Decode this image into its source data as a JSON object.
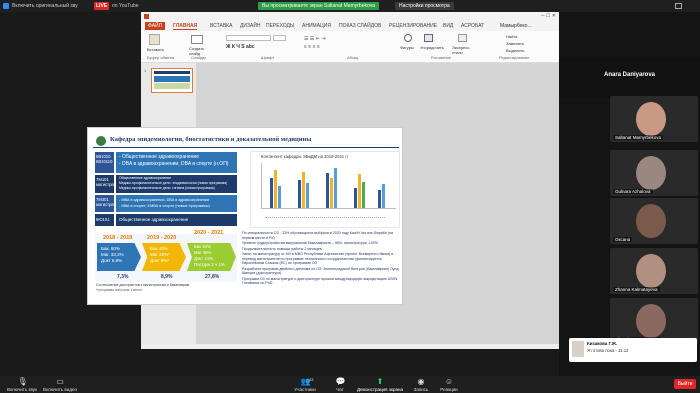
{
  "zoom": {
    "mic_label": "Включить оригинальный зву",
    "live_badge": "LIVE",
    "youtube_label": "on YouTube",
    "share_notice": "Вы просматриваете экран Saltanat Mamyrbekova",
    "view_options": "Настройки просмотра",
    "participants_count": "43",
    "toolbar": {
      "unmute": "Включить звук",
      "video": "Включить видео",
      "participants": "Участники",
      "chat": "Чат",
      "share": "Демонстрация экрана",
      "record": "Запись",
      "reactions": "Реакции",
      "leave": "Выйти"
    }
  },
  "ppt": {
    "tabs": [
      "ФАЙЛ",
      "ГЛАВНАЯ",
      "ВСТАВКА",
      "ДИЗАЙН",
      "ПЕРЕХОДЫ",
      "АНИМАЦИЯ",
      "ПОКАЗ СЛАЙДОВ",
      "РЕЦЕНЗИРОВАНИЕ",
      "ВИД",
      "АСРОБАТ"
    ],
    "user": "Мамырбеко...",
    "ribbon": {
      "paste": "Вставить",
      "create_slide": "Создать слайд",
      "clipboard": "Буфер обмена",
      "slides": "Слайды",
      "font": "Шрифт",
      "paragraph": "Абзац",
      "shapes": "Фигуры",
      "arrange": "Упорядочить",
      "quick_styles": "Экспресс-стили",
      "drawing": "Рисование",
      "find": "Найти",
      "replace": "Заменить",
      "select": "Выделить",
      "editing": "Редактирование"
    },
    "slide_number": "1"
  },
  "slide": {
    "title": "Кафедра эпидемиологии, биостатистики и доказательной медицины",
    "rows": [
      {
        "tag": "6В1010 6В10110",
        "text1": "- Общественное здравоохранение",
        "text2": "- DBA в здравоохранении, DBA в спорте (н.ОП)"
      },
      {
        "tag": "7М101 магистратура",
        "text1": "Общественное здравоохранение",
        "text2": "Медико-профилактическое дело: эпидемиология (новая программа)",
        "text3": "Медико-профилактическое дело: гигиена (новая программа)"
      },
      {
        "tag": "7М401 магистратура",
        "text1": "- МВА в здравоохранении, DBA в здравоохранении",
        "text2": "- МВА в спорте, ЕМВА в спорте (новые программы)"
      },
      {
        "tag": "8Ю101",
        "text1": "Общественное здравоохранение"
      }
    ],
    "chart_title": "Контингент кафедры ЭБиДМ на 2018-2021 гг",
    "years": [
      {
        "label": "2018 - 2019",
        "bak": "Бак.    60%",
        "mag": "Маг.    33,2%",
        "dokt": "Докт   6,8%",
        "pct": "7,3%"
      },
      {
        "label": "2019 - 2020",
        "bak": "Бак    48%",
        "mag": "Маг   45%*",
        "dokt": "Докт   9%*",
        "pct": "8,9%"
      },
      {
        "label": "2020 - 2021",
        "bak": "Бак     33%",
        "mag": "Маг    45%",
        "dokt": "Докт    21%",
        "post": "Постдок 2 ч 1%",
        "pct": "27,8%"
      }
    ],
    "footnote": "Соотношение докторантов к магистрантам и бакалаврам",
    "footnote2": "*программа получила 1 место",
    "bullets": [
      "По специальности ОЗ - 33% обучающиеся выбрали в 2020 году КазНУ им.аль-Фараби (на первом месте в РК)",
      "Уровень трудоустройства выпускников бакалавриата – 98%, магистратура -100%",
      "Продолжительность помощи работы 2 месяцев.",
      "Занят на магистратуру от МЗ в МВО Республики Афганистан (проект Всемирного банка) и перевод магистрантов по программе технического сотрудничества (финансируется Европейским Союзом (ЕС) по программе ОЗ",
      "Разработка программ двойного диплома по ОЗ: Зеленоградской Венгрия (бакалавриат) Лунд Швеция (докторантура)",
      "Программ ОЗ по магистратуре и докторантуре прошли международную аккредитацию ASIIN. Готовимся по PhD."
    ]
  },
  "participants": {
    "header": "Anara Daniyarova",
    "tiles": [
      "Saltanat Mamyrbekova",
      "Gulnara Azhalova",
      "Оксана",
      "Zhanna Kalmatayeva",
      "Aliyash Ospanbayeva"
    ],
    "self_name": "Кизакова Г.Ж.",
    "self_msg": "Я готова пока - 11:12"
  }
}
